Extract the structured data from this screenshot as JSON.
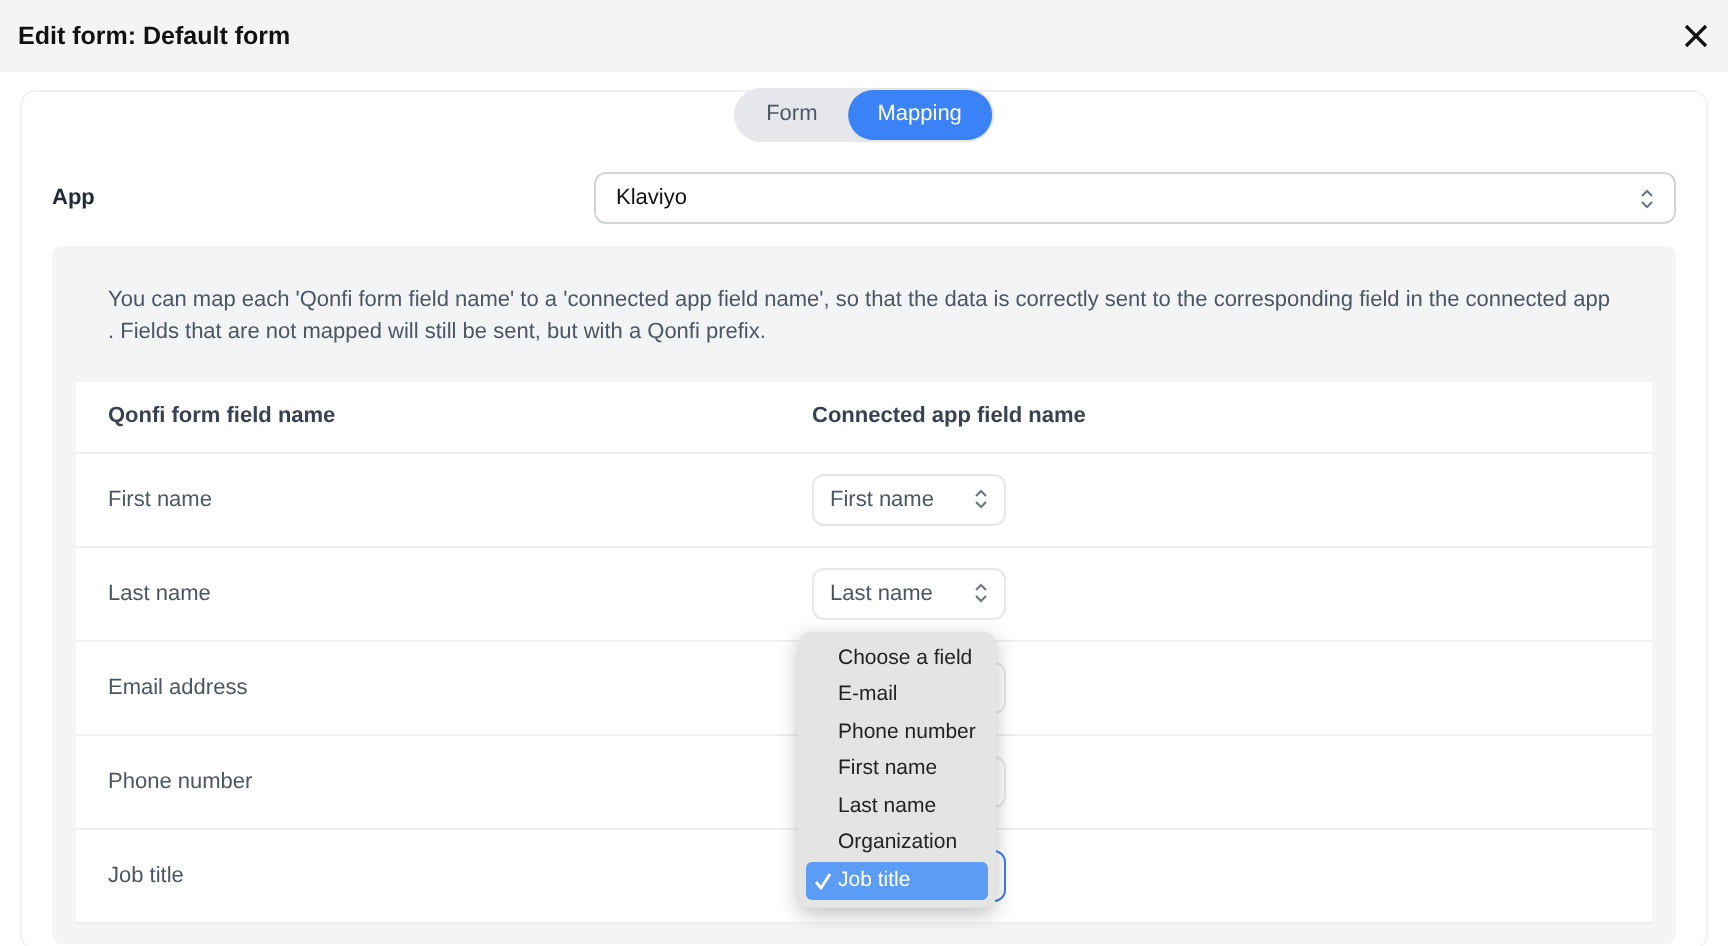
{
  "window": {
    "title": "Edit form: Default form"
  },
  "tabs": [
    {
      "label": "Form",
      "selected": false
    },
    {
      "label": "Mapping",
      "selected": true
    }
  ],
  "app": {
    "label": "App",
    "value": "Klaviyo"
  },
  "info": "You can map each 'Qonfi form field name' to a 'connected app field name', so that the data is correctly sent to the corresponding field in the connected app . Fields that are not mapped will still be sent, but with a Qonfi prefix.",
  "table": {
    "columns": [
      "Qonfi form field name",
      "Connected app field name"
    ],
    "rows": [
      {
        "field": "First name",
        "value": "First name",
        "focused": false
      },
      {
        "field": "Last name",
        "value": "Last name",
        "focused": false
      },
      {
        "field": "Email address",
        "focused": false
      },
      {
        "field": "Phone number",
        "focused": false
      },
      {
        "field": "Job title",
        "focused": true
      }
    ]
  },
  "dropdown_menu": {
    "items": [
      {
        "label": "Choose a field",
        "selected": false
      },
      {
        "label": "E-mail",
        "selected": false
      },
      {
        "label": "Phone number",
        "selected": false
      },
      {
        "label": "First name",
        "selected": false
      },
      {
        "label": "Last name",
        "selected": false
      },
      {
        "label": "Organization",
        "selected": false
      },
      {
        "label": "Job title",
        "selected": true
      }
    ]
  }
}
